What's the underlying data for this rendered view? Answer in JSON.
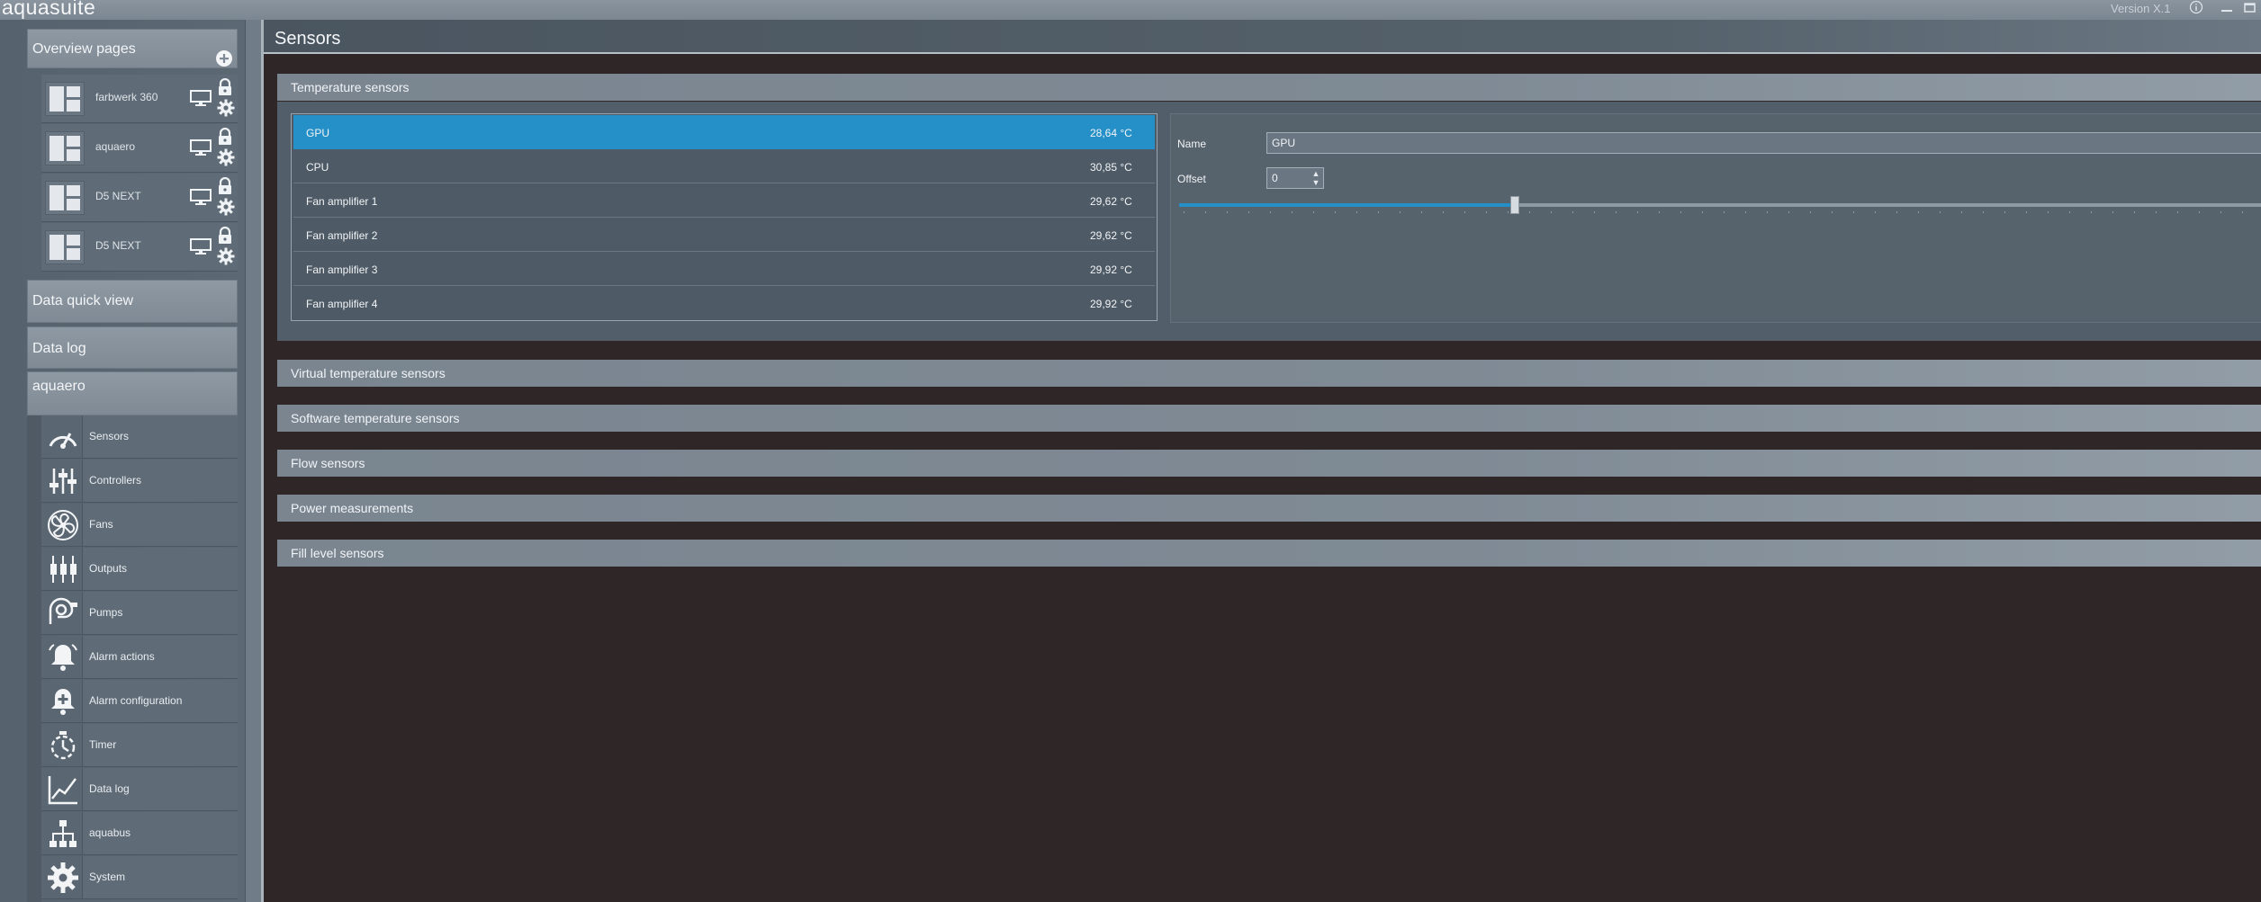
{
  "app": {
    "title": "aquasuite",
    "version": "Version X.1",
    "info_icon": "info-icon",
    "minimize_icon": "minimize-icon",
    "maximize_icon": "maximize-icon"
  },
  "sidebar": {
    "overview_header": "Overview pages",
    "add_icon": "plus-circle-icon",
    "overview_pages": [
      {
        "label": "farbwerk 360"
      },
      {
        "label": "aquaero"
      },
      {
        "label": "D5 NEXT"
      },
      {
        "label": "D5 NEXT"
      }
    ],
    "data_quick_view": "Data quick view",
    "data_log": "Data log",
    "device_header": "aquaero",
    "nav_items": [
      {
        "label": "Sensors",
        "icon": "gauge-icon"
      },
      {
        "label": "Controllers",
        "icon": "sliders-icon"
      },
      {
        "label": "Fans",
        "icon": "fan-icon"
      },
      {
        "label": "Outputs",
        "icon": "outputs-icon"
      },
      {
        "label": "Pumps",
        "icon": "pump-icon"
      },
      {
        "label": "Alarm actions",
        "icon": "bell-icon"
      },
      {
        "label": "Alarm configuration",
        "icon": "bell-settings-icon"
      },
      {
        "label": "Timer",
        "icon": "timer-icon"
      },
      {
        "label": "Data log",
        "icon": "chart-icon"
      },
      {
        "label": "aquabus",
        "icon": "network-icon"
      },
      {
        "label": "System",
        "icon": "gear-icon"
      }
    ]
  },
  "main": {
    "title": "Sensors",
    "temperature_panel": {
      "header": "Temperature sensors",
      "sensors": [
        {
          "name": "GPU",
          "value": "28,64 °C",
          "selected": true
        },
        {
          "name": "CPU",
          "value": "30,85 °C"
        },
        {
          "name": "Fan amplifier 1",
          "value": "29,62 °C"
        },
        {
          "name": "Fan amplifier 2",
          "value": "29,62 °C"
        },
        {
          "name": "Fan amplifier 3",
          "value": "29,92 °C"
        },
        {
          "name": "Fan amplifier 4",
          "value": "29,92 °C"
        }
      ],
      "detail": {
        "name_label": "Name",
        "name_value": "GPU",
        "offset_label": "Offset",
        "offset_value": "0",
        "slider_fraction": 0.31
      }
    },
    "collapsed_panels": [
      "Virtual temperature sensors",
      "Software temperature sensors",
      "Flow sensors",
      "Power measurements",
      "Fill level sensors"
    ]
  },
  "colors": {
    "accent": "#2590c8",
    "background": "#2f2727",
    "panel": "#525e69"
  }
}
